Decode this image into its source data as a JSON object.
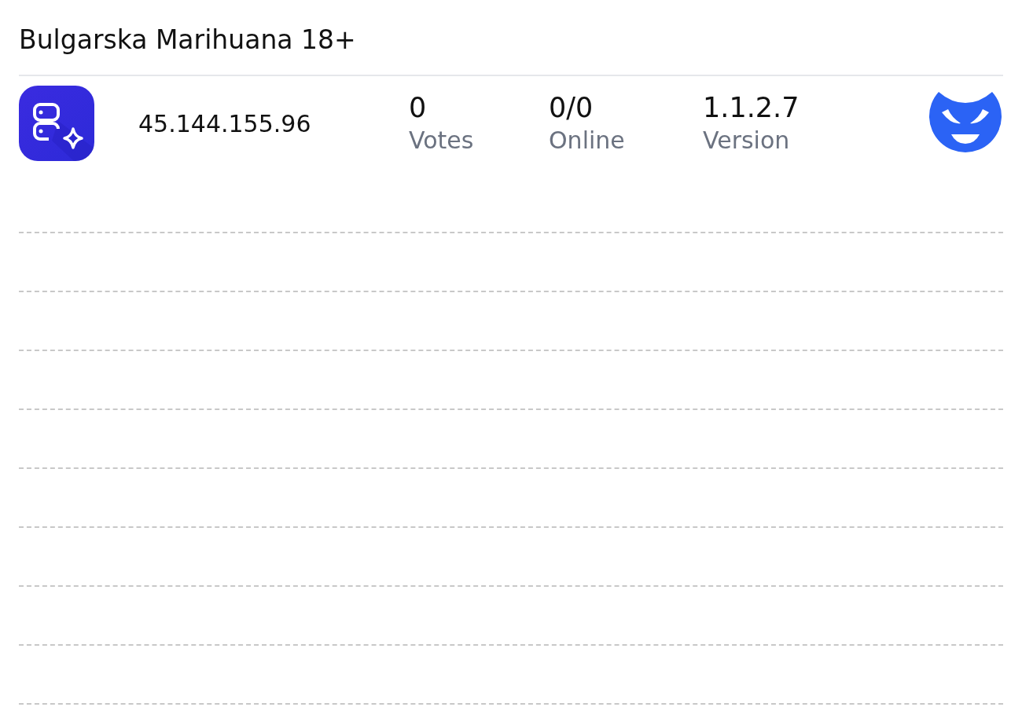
{
  "server": {
    "name": "Bulgarska Marihuana 18+",
    "address": "45.144.155.96",
    "stats": [
      {
        "value": "0",
        "label": "Votes"
      },
      {
        "value": "0/0",
        "label": "Online"
      },
      {
        "value": "1.1.2.7",
        "label": "Version"
      }
    ]
  }
}
